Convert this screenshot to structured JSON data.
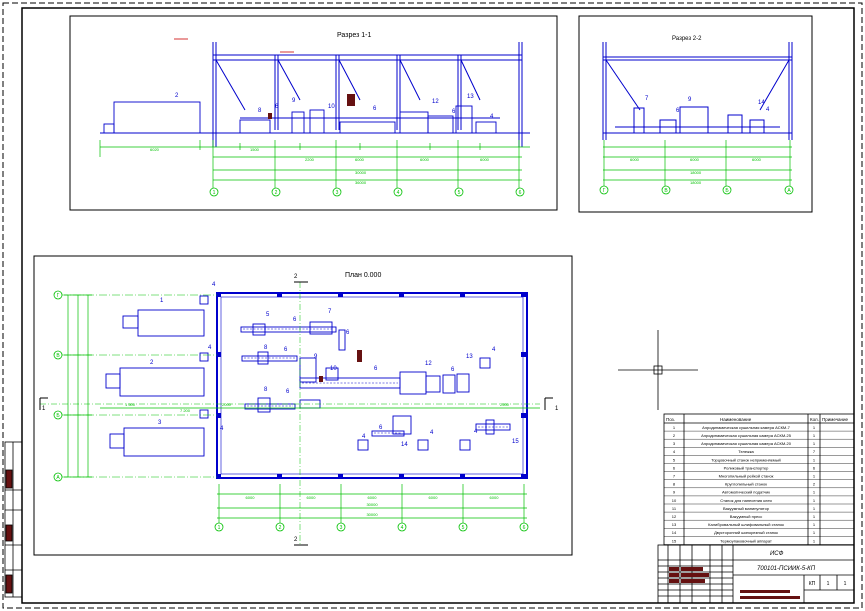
{
  "section11": {
    "title": "Разрез 1-1"
  },
  "section22": {
    "title": "Разрез 2-2"
  },
  "plan": {
    "title": "План 0.000"
  },
  "axes_long": [
    "1",
    "2",
    "3",
    "4",
    "5",
    "6"
  ],
  "axes_cross": [
    "Г",
    "В",
    "Б",
    "А"
  ],
  "section_marks": {
    "s1": "1",
    "s2": "2"
  },
  "spec": {
    "headers": {
      "pos": "Поз.",
      "name": "Наименование",
      "qty": "Кол.",
      "note": "Примечание"
    },
    "rows": [
      {
        "pos": "1",
        "name": "Аэродинамическая сушильная камера АСКМ-7",
        "qty": "1"
      },
      {
        "pos": "2",
        "name": "Аэродинамическая сушильная камера АСКМ-25",
        "qty": "1"
      },
      {
        "pos": "3",
        "name": "Аэродинамическая сушильная камера АСКМ-20",
        "qty": "1"
      },
      {
        "pos": "4",
        "name": "Тележка",
        "qty": "7"
      },
      {
        "pos": "5",
        "name": "Торцовочный станок неприменяемый",
        "qty": "1"
      },
      {
        "pos": "6",
        "name": "Роликовый транспортер",
        "qty": "6"
      },
      {
        "pos": "7",
        "name": "Многопильный рейкой станок",
        "qty": "1"
      },
      {
        "pos": "8",
        "name": "Круглопильный станок",
        "qty": "2"
      },
      {
        "pos": "9",
        "name": "Автоматический податчик",
        "qty": "1"
      },
      {
        "pos": "10",
        "name": "Станок для нанесения клея",
        "qty": "1"
      },
      {
        "pos": "11",
        "name": "Вакуумный манипулятор",
        "qty": "1"
      },
      {
        "pos": "12",
        "name": "Вакуумный пресс",
        "qty": "1"
      },
      {
        "pos": "13",
        "name": "Калибровальный шлифовальный станок",
        "qty": "1"
      },
      {
        "pos": "14",
        "name": "Двусторонний шипорезный станок",
        "qty": "1"
      },
      {
        "pos": "15",
        "name": "Термоупаковочный аппарат",
        "qty": "1"
      }
    ]
  },
  "title_block": {
    "org": "ИСФ",
    "code": "700101-ПСИИК-5-КП",
    "stage": "КП",
    "sheet": "1",
    "sheets": "1"
  },
  "dims_plan": [
    "6000",
    "6000",
    "6000",
    "6000",
    "6000",
    "30000",
    "30000"
  ],
  "dims_sec11": [
    "30000",
    "36000"
  ],
  "dims_sec22": [
    "18000",
    "18000"
  ],
  "colors": {
    "green": "#00c000",
    "blue": "#0000cc",
    "red": "#cc0000",
    "black": "#000000"
  }
}
